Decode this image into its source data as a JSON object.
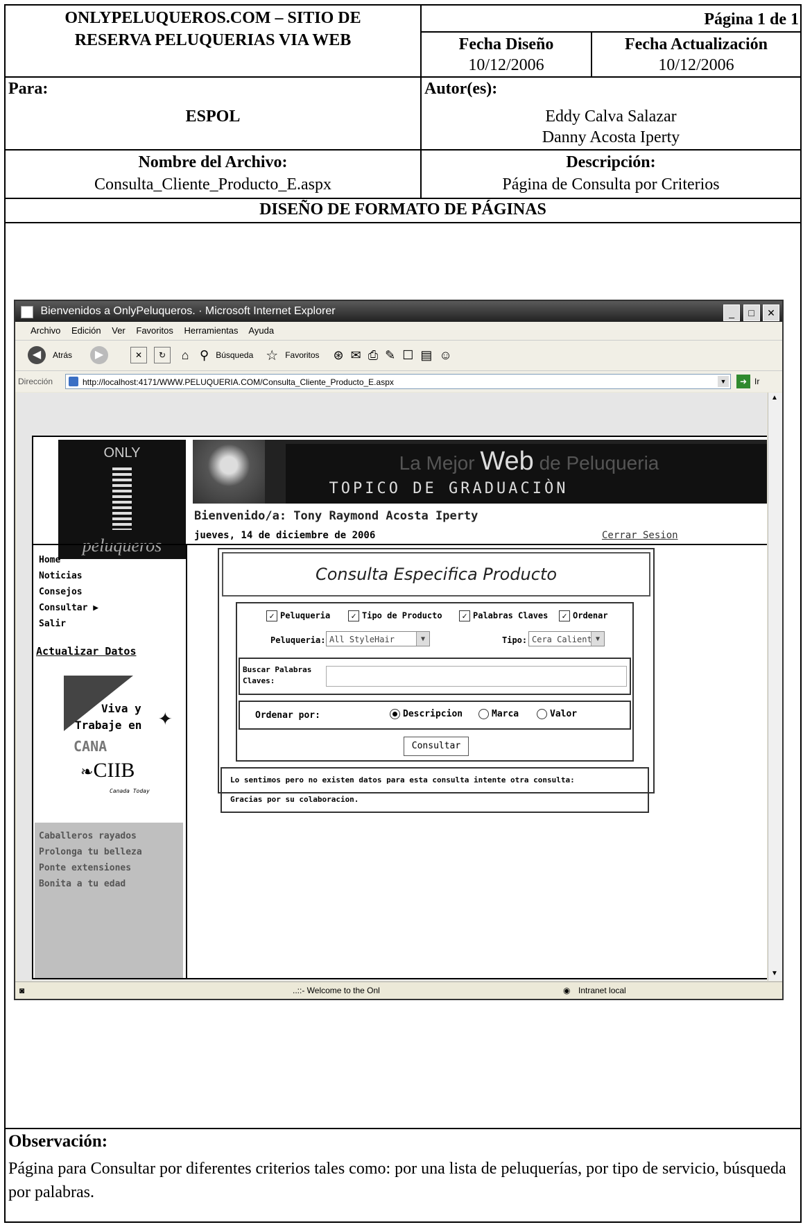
{
  "header": {
    "title_line1": "ONLYPELUQUEROS.COM – SITIO DE",
    "title_line2": "RESERVA PELUQUERIAS VIA WEB",
    "page_label": "Página 1 de 1",
    "fecha_diseno_label": "Fecha Diseño",
    "fecha_diseno": "10/12/2006",
    "fecha_act_label": "Fecha Actualización",
    "fecha_act": "10/12/2006",
    "para_label": "Para:",
    "para_value": "ESPOL",
    "autores_label": "Autor(es):",
    "autor1": "Eddy Calva Salazar",
    "autor2": "Danny Acosta Iperty",
    "archivo_label": "Nombre del Archivo:",
    "archivo_value": "Consulta_Cliente_Producto_E.aspx",
    "descripcion_label": "Descripción:",
    "descripcion_value": "Página  de Consulta por Criterios",
    "section_title": "DISEÑO DE FORMATO DE PÁGINAS"
  },
  "browser": {
    "title": "Bienvenidos a OnlyPeluqueros.  ·  Microsoft Internet Explorer",
    "menu": [
      "Archivo",
      "Edición",
      "Ver",
      "Favoritos",
      "Herramientas",
      "Ayuda"
    ],
    "toolbar": {
      "back": "Atrás",
      "search": "Búsqueda",
      "favorites": "Favoritos"
    },
    "address_label": "Dirección",
    "url": "http://localhost:4171/WWW.PELUQUERIA.COM/Consulta_Cliente_Producto_E.aspx",
    "go_label": "Ir",
    "status_text": "..::- Welcome to the Onl",
    "zone": "Intranet local"
  },
  "site": {
    "logo_top": "ONLY",
    "logo_bottom": "peluqueros",
    "banner_line1_a": "La Mejor ",
    "banner_line1_b": "Web",
    "banner_line1_c": " de Peluqueria",
    "banner_line2": "TOPICO DE GRADUACIÒN",
    "welcome": "Bienvenido/a: Tony Raymond Acosta Iperty",
    "date": "jueves, 14 de diciembre de 2006",
    "logout": "Cerrar Sesion",
    "nav": [
      "Home",
      "Noticias",
      "Consejos",
      "Consultar",
      "Salir"
    ],
    "update": "Actualizar Datos",
    "ad_line1": "Viva y",
    "ad_line2": "Trabaje en",
    "ad_line3": "CANA",
    "ad_brand": "CIIB",
    "ad_small": "Canada Today",
    "promo": [
      "Caballeros rayados",
      "Prolonga tu belleza",
      "Ponte extensiones",
      "Bonita a tu edad"
    ],
    "panel_title": "Consulta Especifica Producto",
    "chk_peluqueria": "Peluqueria",
    "chk_tipo": "Tipo de Producto",
    "chk_palabras": "Palabras Claves",
    "chk_ordenar": "Ordenar",
    "peluqueria_label": "Peluqueria:",
    "peluqueria_value": "All StyleHair",
    "tipo_label": "Tipo:",
    "tipo_value": "Cera Calient",
    "buscar_label_1": "Buscar Palabras",
    "buscar_label_2": "Claves:",
    "ordenar_label": "Ordenar  por:",
    "radio_descripcion": "Descripcion",
    "radio_marca": "Marca",
    "radio_valor": "Valor",
    "consultar_btn": "Consultar",
    "msg1": "Lo sentimos pero no existen datos para esta consulta intente otra consulta:",
    "msg2": "Gracias por su colaboracion."
  },
  "footer": {
    "obs_label": "Observación:",
    "obs_text": "Página para Consultar por diferentes criterios tales como: por una lista de peluquerías, por tipo de servicio, búsqueda por palabras."
  }
}
